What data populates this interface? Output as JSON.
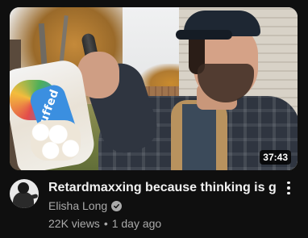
{
  "video": {
    "title": "Retardmaxxing because thinking is gay",
    "duration": "37:43",
    "channel": "Elisha Long",
    "channel_verified": true,
    "views": "22K views",
    "separator": "•",
    "age": "1 day ago",
    "thumbnail_bag_text": "Puffed"
  },
  "icons": {
    "verified": "verified-check-icon",
    "more": "more-vertical-icon"
  },
  "colors": {
    "background": "#0f0f0f",
    "title_text": "#f1f1f1",
    "secondary_text": "#aaaaaa",
    "duration_badge_bg": "#000000"
  }
}
